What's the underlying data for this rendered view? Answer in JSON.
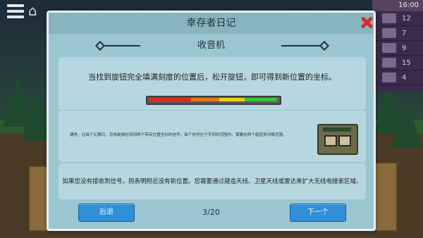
{
  "hud": {
    "time": "16:00",
    "resources": [
      {
        "icon": "resource-icon",
        "value": "12"
      },
      {
        "icon": "resource-icon",
        "value": "7"
      },
      {
        "icon": "resource-icon",
        "value": "9"
      },
      {
        "icon": "resource-icon",
        "value": "15"
      },
      {
        "icon": "resource-icon",
        "value": "4"
      }
    ]
  },
  "dialog": {
    "title": "幸存者日记",
    "section_title": "收音机",
    "card1_text": "当找到旋钮完全填满刻度的位置后，松开旋钮，即可得到新位置的坐标。",
    "meter_fill": 1.0,
    "card2_text": "通常，在每个比赛日，您将能够检测到两个带有位置坐标的信号。每个信号位于不同的范围内。需要这两个旋钮来切换范围。",
    "card3_text": "如果您没有接收到信号，则表明附近没有新位置。您需要通过建造天线、卫星天线或雷达来扩大无线电搜索区域。",
    "back_label": "后退",
    "page_indicator": "3/20",
    "next_label": "下一个"
  },
  "colors": {
    "dialog_bg": "#9bc6d1",
    "card_bg": "#b6d7df",
    "button": "#2f8fd8",
    "close": "#d7282c"
  }
}
